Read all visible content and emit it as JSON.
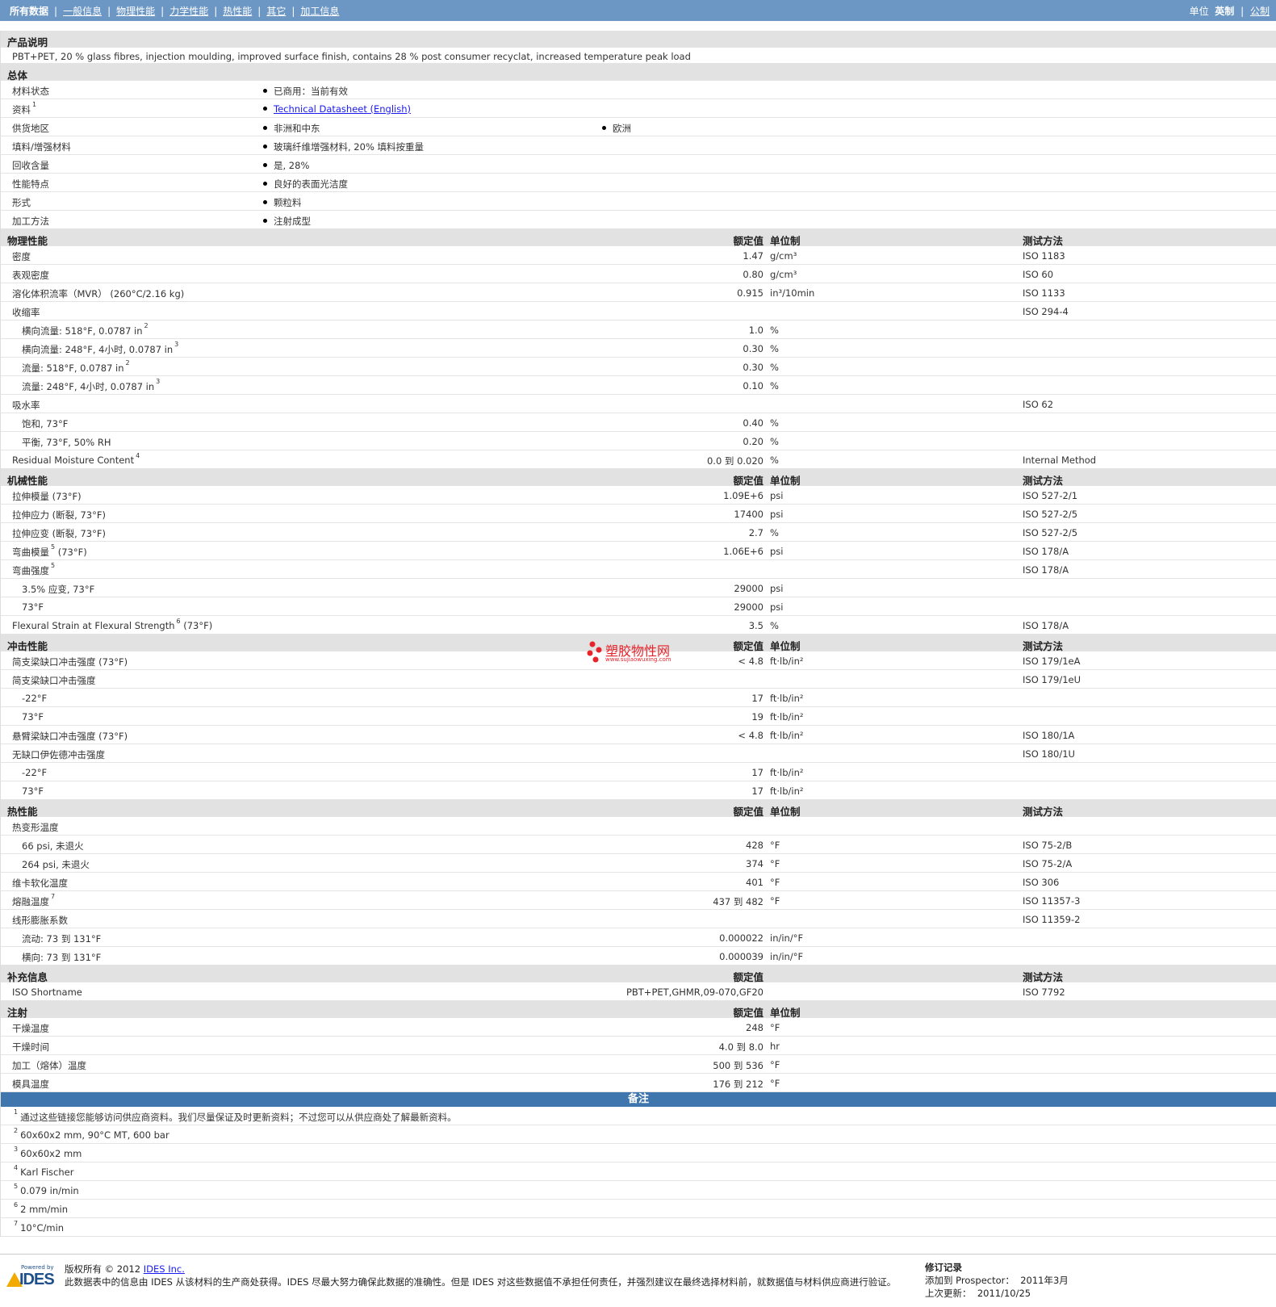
{
  "nav": {
    "items": [
      {
        "label": "所有数据",
        "current": true
      },
      {
        "label": "一般信息"
      },
      {
        "label": "物理性能"
      },
      {
        "label": "力学性能"
      },
      {
        "label": "热性能"
      },
      {
        "label": "其它"
      },
      {
        "label": "加工信息"
      }
    ],
    "units_label": "单位",
    "unit_options": [
      {
        "label": "英制",
        "current": true
      },
      {
        "label": "公制"
      }
    ]
  },
  "description": {
    "title": "产品说明",
    "text": "PBT+PET, 20 % glass fibres, injection moulding, improved surface finish, contains 28 % post consumer recyclat, increased temperature peak load"
  },
  "general": {
    "title": "总体",
    "rows": [
      {
        "label": "材料状态",
        "values": [
          "已商用：当前有效"
        ]
      },
      {
        "label": "资料",
        "sup": "1",
        "values": [
          "Technical Datasheet (English)"
        ],
        "link": true
      },
      {
        "label": "供货地区",
        "values": [
          "非洲和中东",
          "欧洲"
        ]
      },
      {
        "label": "填料/增强材料",
        "values": [
          "玻璃纤维增强材料, 20% 填料按重量"
        ]
      },
      {
        "label": "回收含量",
        "values": [
          "是, 28%"
        ]
      },
      {
        "label": "性能特点",
        "values": [
          "良好的表面光洁度"
        ]
      },
      {
        "label": "形式",
        "values": [
          "颗粒料"
        ]
      },
      {
        "label": "加工方法",
        "values": [
          "注射成型"
        ]
      }
    ]
  },
  "sections": [
    {
      "title": "物理性能",
      "headers": {
        "value": "额定值",
        "unit": "单位制",
        "test": "测试方法"
      },
      "rows": [
        {
          "label": "密度",
          "value": "1.47",
          "unit": "g/cm³",
          "test": "ISO 1183"
        },
        {
          "label": "表观密度",
          "value": "0.80",
          "unit": "g/cm³",
          "test": "ISO 60"
        },
        {
          "label": "溶化体积流率（MVR） (260°C/2.16 kg)",
          "value": "0.915",
          "unit": "in³/10min",
          "test": "ISO 1133"
        },
        {
          "label": "收缩率",
          "value": "",
          "unit": "",
          "test": "ISO 294-4"
        },
        {
          "label": "横向流量: 518°F, 0.0787 in",
          "sup": "2",
          "sub": true,
          "value": "1.0",
          "unit": "%",
          "test": ""
        },
        {
          "label": "横向流量: 248°F, 4小时, 0.0787 in",
          "sup": "3",
          "sub": true,
          "value": "0.30",
          "unit": "%",
          "test": ""
        },
        {
          "label": "流量: 518°F, 0.0787 in",
          "sup": "2",
          "sub": true,
          "value": "0.30",
          "unit": "%",
          "test": ""
        },
        {
          "label": "流量: 248°F, 4小时, 0.0787 in",
          "sup": "3",
          "sub": true,
          "value": "0.10",
          "unit": "%",
          "test": ""
        },
        {
          "label": "吸水率",
          "value": "",
          "unit": "",
          "test": "ISO 62"
        },
        {
          "label": "饱和, 73°F",
          "sub": true,
          "value": "0.40",
          "unit": "%",
          "test": ""
        },
        {
          "label": "平衡, 73°F, 50% RH",
          "sub": true,
          "value": "0.20",
          "unit": "%",
          "test": ""
        },
        {
          "label": "Residual Moisture Content",
          "sup": "4",
          "value": "0.0 到 0.020",
          "unit": "%",
          "test": "Internal Method"
        }
      ]
    },
    {
      "title": "机械性能",
      "headers": {
        "value": "额定值",
        "unit": "单位制",
        "test": "测试方法"
      },
      "rows": [
        {
          "label": "拉伸模量 (73°F)",
          "value": "1.09E+6",
          "unit": "psi",
          "test": "ISO 527-2/1"
        },
        {
          "label": "拉伸应力 (断裂, 73°F)",
          "value": "17400",
          "unit": "psi",
          "test": "ISO 527-2/5"
        },
        {
          "label": "拉伸应变 (断裂, 73°F)",
          "value": "2.7",
          "unit": "%",
          "test": "ISO 527-2/5"
        },
        {
          "label": "弯曲模量",
          "sup": "5",
          "suffix": " (73°F)",
          "value": "1.06E+6",
          "unit": "psi",
          "test": "ISO 178/A"
        },
        {
          "label": "弯曲强度",
          "sup": "5",
          "value": "",
          "unit": "",
          "test": "ISO 178/A"
        },
        {
          "label": "3.5% 应变, 73°F",
          "sub": true,
          "value": "29000",
          "unit": "psi",
          "test": ""
        },
        {
          "label": "73°F",
          "sub": true,
          "value": "29000",
          "unit": "psi",
          "test": ""
        },
        {
          "label": "Flexural Strain at Flexural Strength",
          "sup": "6",
          "suffix": " (73°F)",
          "value": "3.5",
          "unit": "%",
          "test": "ISO 178/A"
        }
      ]
    },
    {
      "title": "冲击性能",
      "headers": {
        "value": "额定值",
        "unit": "单位制",
        "test": "测试方法"
      },
      "rows": [
        {
          "label": "简支梁缺口冲击强度 (73°F)",
          "value": "< 4.8",
          "unit": "ft·lb/in²",
          "test": "ISO 179/1eA"
        },
        {
          "label": "简支梁缺口冲击强度",
          "value": "",
          "unit": "",
          "test": "ISO 179/1eU"
        },
        {
          "label": "-22°F",
          "sub": true,
          "value": "17",
          "unit": "ft·lb/in²",
          "test": ""
        },
        {
          "label": "73°F",
          "sub": true,
          "value": "19",
          "unit": "ft·lb/in²",
          "test": ""
        },
        {
          "label": "悬臂梁缺口冲击强度 (73°F)",
          "value": "< 4.8",
          "unit": "ft·lb/in²",
          "test": "ISO 180/1A"
        },
        {
          "label": "无缺口伊佐德冲击强度",
          "value": "",
          "unit": "",
          "test": "ISO 180/1U"
        },
        {
          "label": "-22°F",
          "sub": true,
          "value": "17",
          "unit": "ft·lb/in²",
          "test": ""
        },
        {
          "label": "73°F",
          "sub": true,
          "value": "17",
          "unit": "ft·lb/in²",
          "test": ""
        }
      ]
    },
    {
      "title": "热性能",
      "headers": {
        "value": "额定值",
        "unit": "单位制",
        "test": "测试方法"
      },
      "rows": [
        {
          "label": "热变形温度",
          "value": "",
          "unit": "",
          "test": ""
        },
        {
          "label": "66 psi, 未退火",
          "sub": true,
          "value": "428",
          "unit": "°F",
          "test": "ISO 75-2/B"
        },
        {
          "label": "264 psi, 未退火",
          "sub": true,
          "value": "374",
          "unit": "°F",
          "test": "ISO 75-2/A"
        },
        {
          "label": "维卡软化温度",
          "value": "401",
          "unit": "°F",
          "test": "ISO 306"
        },
        {
          "label": "熔融温度",
          "sup": "7",
          "value": "437 到 482",
          "unit": "°F",
          "test": "ISO 11357-3"
        },
        {
          "label": "线形膨胀系数",
          "value": "",
          "unit": "",
          "test": "ISO 11359-2"
        },
        {
          "label": "流动: 73 到 131°F",
          "sub": true,
          "value": "0.000022",
          "unit": "in/in/°F",
          "test": ""
        },
        {
          "label": "横向: 73 到 131°F",
          "sub": true,
          "value": "0.000039",
          "unit": "in/in/°F",
          "test": ""
        }
      ]
    },
    {
      "title": "补充信息",
      "headers": {
        "value": "额定值",
        "unit": "",
        "test": "测试方法"
      },
      "rows": [
        {
          "label": "ISO Shortname",
          "value": "PBT+PET,GHMR,09-070,GF20",
          "unit": "",
          "test": "ISO 7792"
        }
      ]
    },
    {
      "title": "注射",
      "headers": {
        "value": "额定值",
        "unit": "单位制",
        "test": ""
      },
      "rows": [
        {
          "label": "干燥温度",
          "value": "248",
          "unit": "°F",
          "test": ""
        },
        {
          "label": "干燥时间",
          "value": "4.0 到 8.0",
          "unit": "hr",
          "test": ""
        },
        {
          "label": "加工（熔体）温度",
          "value": "500 到 536",
          "unit": "°F",
          "test": ""
        },
        {
          "label": "模具温度",
          "value": "176 到 212",
          "unit": "°F",
          "test": ""
        }
      ]
    }
  ],
  "notes": {
    "title": "备注",
    "items": [
      {
        "n": "1",
        "text": "通过这些链接您能够访问供应商资料。我们尽量保证及时更新资料；不过您可以从供应商处了解最新资料。"
      },
      {
        "n": "2",
        "text": "60x60x2 mm, 90°C MT, 600 bar"
      },
      {
        "n": "3",
        "text": "60x60x2 mm"
      },
      {
        "n": "4",
        "text": "Karl Fischer"
      },
      {
        "n": "5",
        "text": "0.079 in/min"
      },
      {
        "n": "6",
        "text": "2 mm/min"
      },
      {
        "n": "7",
        "text": "10°C/min"
      }
    ]
  },
  "watermark": {
    "line1": "塑胶物性网",
    "line2": "www.sujiaowuxing.com"
  },
  "footer": {
    "powered_by": "Powered by",
    "logo_text": "IDES",
    "copyright_prefix": "版权所有 © 2012 ",
    "copyright_link": "IDES Inc.",
    "disclaimer": "此数据表中的信息由 IDES 从该材料的生产商处获得。IDES 尽最大努力确保此数据的准确性。但是 IDES 对这些数据值不承担任何责任，并强烈建议在最终选择材料前，就数据值与材料供应商进行验证。",
    "revision_title": "修订记录",
    "added_label": "添加到 Prospector：",
    "added_value": "2011年3月",
    "updated_label": "上次更新：",
    "updated_value": "2011/10/25"
  },
  "colors": {
    "topbar": "#6c97c4",
    "section_bg": "#e2e2e2",
    "notes_bar": "#3f76ad",
    "link": "#1a1aee"
  }
}
